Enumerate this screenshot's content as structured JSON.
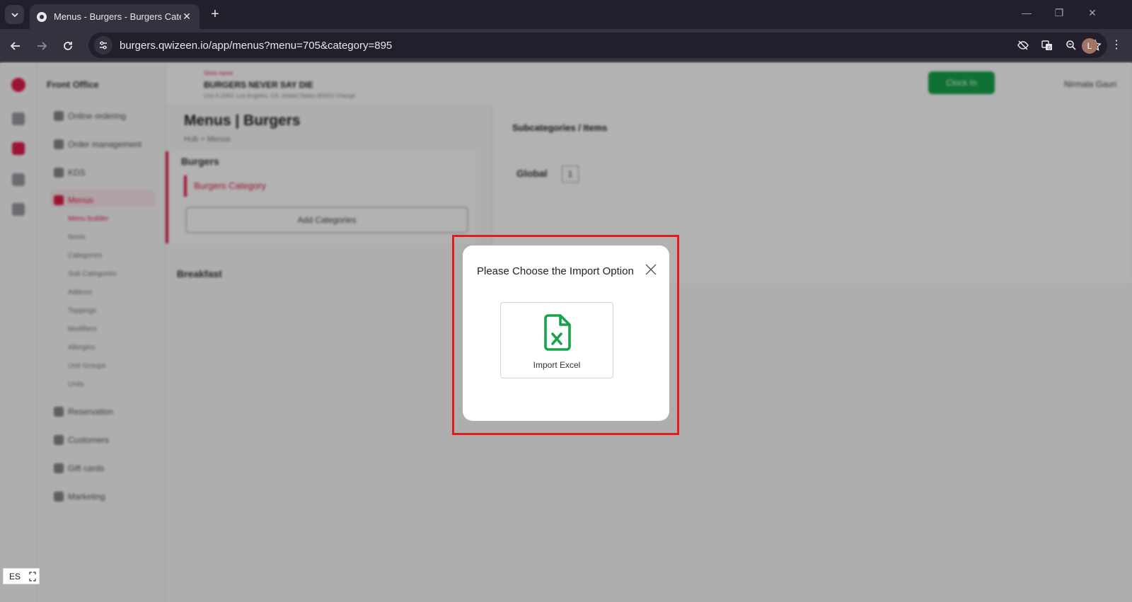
{
  "browser": {
    "tab_title": "Menus - Burgers - Burgers Cate",
    "url": "burgers.qwizeen.io/app/menus?menu=705&category=895",
    "profile_initial": "L"
  },
  "app": {
    "section_title": "Front Office",
    "sidebar_items": [
      "Online ordering",
      "Order management",
      "KDS",
      "Menus",
      "Reservation",
      "Customers",
      "Gift cards",
      "Marketing"
    ],
    "menus_subitems": [
      "Menu builder",
      "Items",
      "Categories",
      "Sub Categories",
      "Addons",
      "Toppings",
      "Modifiers",
      "Allergies",
      "Unit Groups",
      "Units"
    ],
    "store_small": "Store name",
    "store_name": "BURGERS NEVER SAY DIE",
    "store_address": "Unit A-2083, Los Angeles, CA, United States 900XX Change",
    "clock_in": "Clock In",
    "user_name": "Nirmala Gauri",
    "page_title": "Menus | Burgers",
    "breadcrumb": "Hub  >  Menus",
    "menu_group": "Burgers",
    "category_item": "Burgers Category",
    "add_categories": "Add Categories",
    "second_group": "Breakfast",
    "right_title": "Subcategories / Items",
    "global_label": "Global",
    "global_count": "1"
  },
  "modal": {
    "title": "Please Choose the Import Option",
    "option_label": "Import Excel",
    "option_icon": "excel-file-icon",
    "accent": "#16a34a"
  },
  "lang_widget": {
    "code": "ES"
  },
  "colors": {
    "brand": "#e11d48",
    "highlight": "#e31b1b",
    "success": "#16a34a"
  }
}
